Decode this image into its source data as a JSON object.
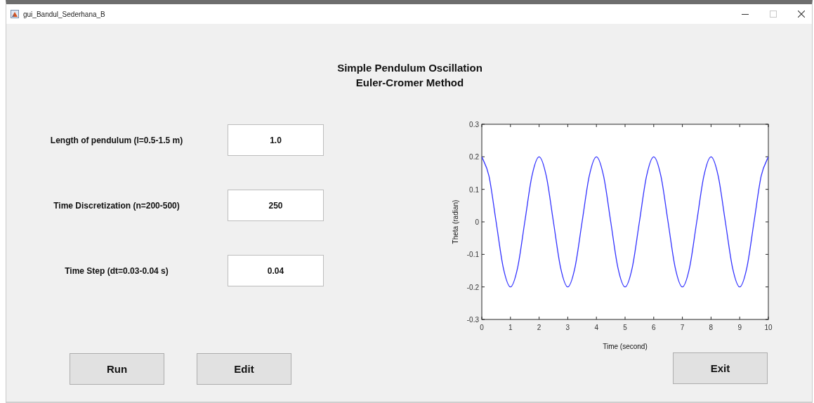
{
  "window": {
    "title": "gui_Bandul_Sederhana_B"
  },
  "heading": [
    "Simple Pendulum Oscillation",
    "Euler-Cromer Method"
  ],
  "inputs": [
    {
      "label": "Length of pendulum (l=0.5-1.5 m)",
      "value": "1.0"
    },
    {
      "label": "Time Discretization (n=200-500)",
      "value": "250"
    },
    {
      "label": "Time Step (dt=0.03-0.04 s)",
      "value": "0.04"
    }
  ],
  "buttons": [
    "Run",
    "Edit"
  ],
  "plot": {
    "chart_data": {
      "type": "line",
      "xlabel": "Time (second)",
      "ylabel": "Theta (radian)",
      "x": [
        0,
        0.25,
        0.5,
        0.75,
        1,
        1.25,
        1.5,
        1.75,
        2,
        2.25,
        2.5,
        2.75,
        3,
        3.25,
        3.5,
        3.75,
        4,
        4.25,
        4.5,
        4.75,
        5,
        5.25,
        5.5,
        5.75,
        6,
        6.25,
        6.5,
        6.75,
        7,
        7.25,
        7.5,
        7.75,
        8,
        8.25,
        8.5,
        8.75,
        9,
        9.25,
        9.5,
        9.75,
        10
      ],
      "series": [
        {
          "color": "#3333ff",
          "values": [
            0.2,
            0.141,
            0,
            -0.141,
            -0.2,
            -0.141,
            0,
            0.141,
            0.2,
            0.141,
            0,
            -0.141,
            -0.2,
            -0.141,
            0,
            0.141,
            0.2,
            0.141,
            0,
            -0.141,
            -0.2,
            -0.141,
            0,
            0.141,
            0.2,
            0.141,
            0,
            -0.141,
            -0.2,
            -0.141,
            0,
            0.141,
            0.2,
            0.141,
            0,
            -0.141,
            -0.2,
            -0.141,
            0,
            0.141,
            0.2
          ]
        }
      ],
      "xlim": [
        0,
        10
      ],
      "ylim": [
        -0.3,
        0.3
      ],
      "xticks": [
        0,
        1,
        2,
        3,
        4,
        5,
        6,
        7,
        8,
        9,
        10
      ],
      "yticks": [
        -0.3,
        -0.2,
        -0.1,
        0,
        0.1,
        0.2,
        0.3
      ]
    }
  },
  "exit_button": "Exit"
}
